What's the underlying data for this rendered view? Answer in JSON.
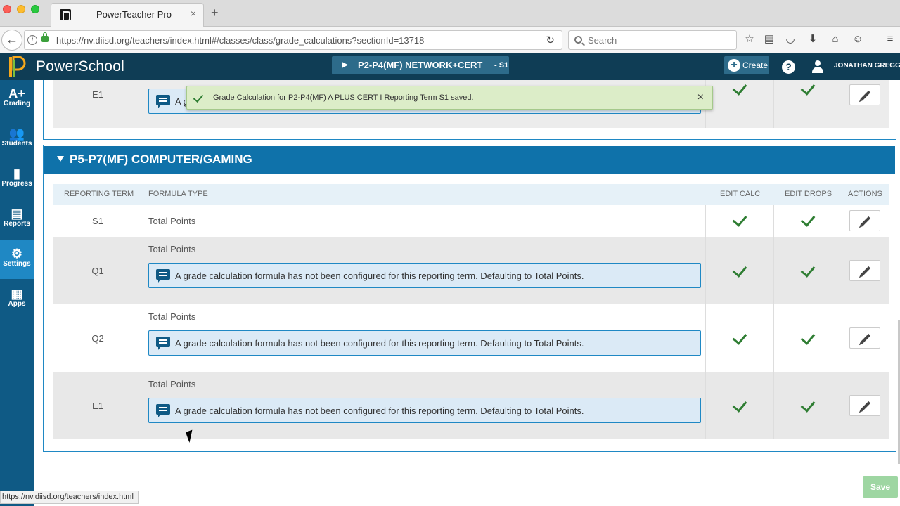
{
  "browser": {
    "tab_title": "PowerTeacher Pro",
    "tab_close": "×",
    "new_tab": "+",
    "url": "https://nv.diisd.org/teachers/index.html#/classes/class/grade_calculations?sectionId=13718",
    "search_placeholder": "Search",
    "status_url": "https://nv.diisd.org/teachers/index.html"
  },
  "app": {
    "brand": "PowerSchool",
    "section_label": "P2-P4(MF) NETWORK+CERT",
    "section_term": "-  S1",
    "create_label": "Create",
    "help_label": "?",
    "user_name": "JONATHAN GREGG"
  },
  "sidebar": {
    "items": [
      {
        "label": "Grading",
        "glyph": "A+"
      },
      {
        "label": "Students",
        "glyph": "👥"
      },
      {
        "label": "Progress",
        "glyph": "▮"
      },
      {
        "label": "Reports",
        "glyph": "▤"
      },
      {
        "label": "Settings",
        "glyph": "⚙"
      },
      {
        "label": "Apps",
        "glyph": "▦"
      }
    ]
  },
  "toast": {
    "message": "Grade Calculation for P2-P4(MF) A PLUS CERT I Reporting Term S1 saved.",
    "close": "×"
  },
  "top_panel": {
    "row": {
      "term": "E1",
      "partial_text": "A g"
    }
  },
  "section": {
    "title": "P5-P7(MF) COMPUTER/GAMING",
    "columns": {
      "term": "REPORTING TERM",
      "formula": "FORMULA TYPE",
      "edit_calc": "EDIT CALC",
      "edit_drops": "EDIT DROPS",
      "actions": "ACTIONS"
    },
    "rows": [
      {
        "term": "S1",
        "formula": "Total Points",
        "notice": ""
      },
      {
        "term": "Q1",
        "formula": "Total Points",
        "notice": "A grade calculation formula has not been configured for this reporting term. Defaulting to Total Points."
      },
      {
        "term": "Q2",
        "formula": "Total Points",
        "notice": "A grade calculation formula has not been configured for this reporting term. Defaulting to Total Points."
      },
      {
        "term": "E1",
        "formula": "Total Points",
        "notice": "A grade calculation formula has not been configured for this reporting term. Defaulting to Total Points."
      }
    ]
  },
  "footer": {
    "save_label": "Save"
  },
  "colors": {
    "header": "#0f3d55",
    "sidebar": "#0f5a85",
    "accent": "#1f88c4",
    "check": "#2e7d32"
  }
}
